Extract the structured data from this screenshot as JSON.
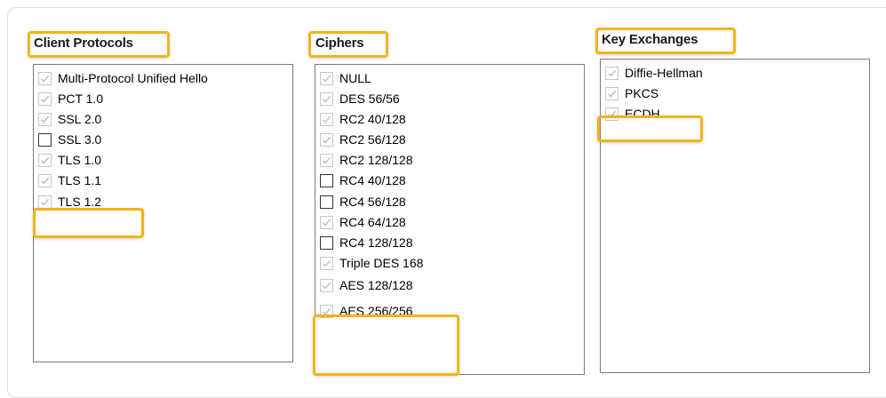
{
  "groups": [
    {
      "title": "Client Protocols",
      "items": [
        {
          "label": "Multi-Protocol Unified Hello",
          "checked": true
        },
        {
          "label": "PCT 1.0",
          "checked": true
        },
        {
          "label": "SSL 2.0",
          "checked": true
        },
        {
          "label": "SSL 3.0",
          "checked": false
        },
        {
          "label": "TLS 1.0",
          "checked": true
        },
        {
          "label": "TLS 1.1",
          "checked": true
        },
        {
          "label": "TLS 1.2",
          "checked": true
        }
      ]
    },
    {
      "title": "Ciphers",
      "items": [
        {
          "label": "NULL",
          "checked": true
        },
        {
          "label": "DES 56/56",
          "checked": true
        },
        {
          "label": "RC2 40/128",
          "checked": true
        },
        {
          "label": "RC2 56/128",
          "checked": true
        },
        {
          "label": "RC2 128/128",
          "checked": true
        },
        {
          "label": "RC4 40/128",
          "checked": false
        },
        {
          "label": "RC4 56/128",
          "checked": false
        },
        {
          "label": "RC4 64/128",
          "checked": true
        },
        {
          "label": "RC4 128/128",
          "checked": false
        },
        {
          "label": "Triple DES 168",
          "checked": true
        },
        {
          "label": "AES 128/128",
          "checked": true
        },
        {
          "label": "AES 256/256",
          "checked": true
        }
      ]
    },
    {
      "title": "Key Exchanges",
      "items": [
        {
          "label": "Diffie-Hellman",
          "checked": true
        },
        {
          "label": "PKCS",
          "checked": true
        },
        {
          "label": "ECDH",
          "checked": true
        }
      ]
    }
  ],
  "colors": {
    "highlight": "#f5b318",
    "checkbox_disabled": "#c6c6c6",
    "checkmark_disabled": "#b8b8b8",
    "listbox_border": "#7a7a7a"
  }
}
